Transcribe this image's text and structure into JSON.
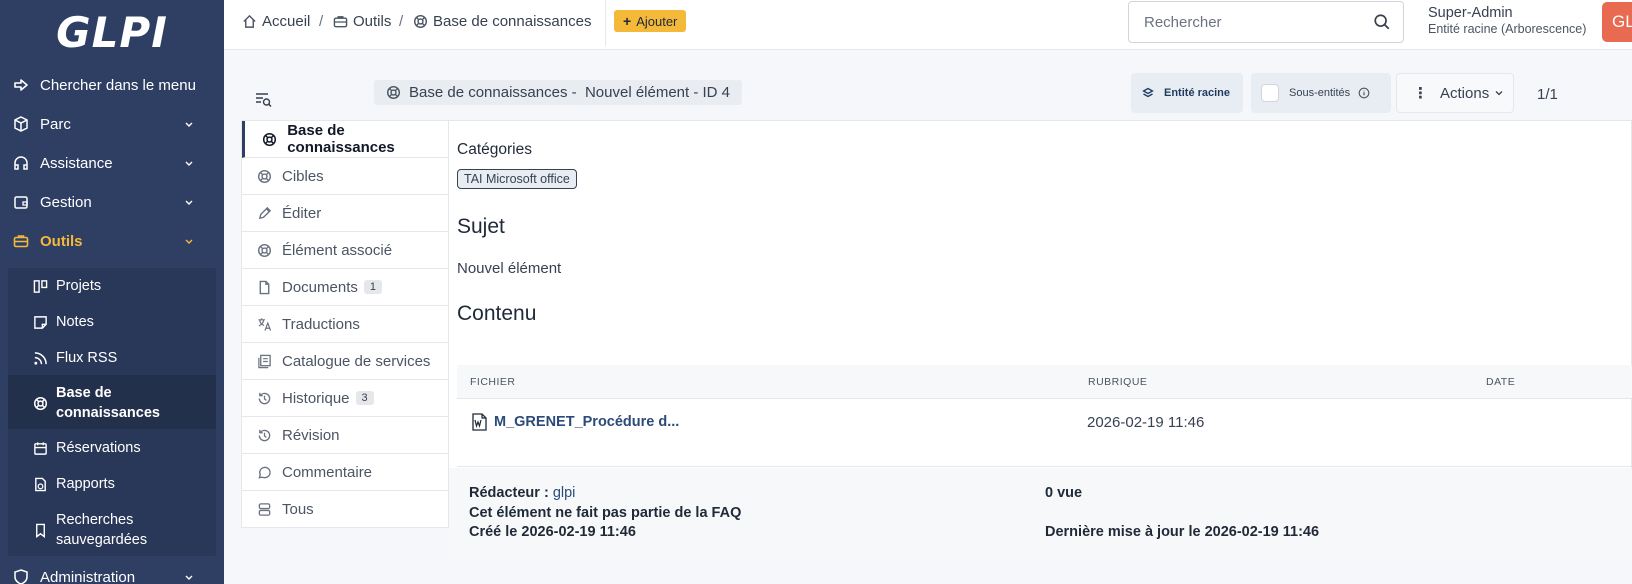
{
  "sidebar": {
    "logo": "GLPI",
    "menu": [
      {
        "label": "Chercher dans le menu",
        "icon": "arrow-right-icon"
      },
      {
        "label": "Parc",
        "icon": "cube-icon"
      },
      {
        "label": "Assistance",
        "icon": "headset-icon"
      },
      {
        "label": "Gestion",
        "icon": "wallet-icon"
      },
      {
        "label": "Outils",
        "icon": "briefcase-icon"
      },
      {
        "label": "Administration",
        "icon": "shield-icon"
      }
    ],
    "submenu": [
      {
        "label": "Projets",
        "icon": "project-icon"
      },
      {
        "label": "Notes",
        "icon": "note-icon"
      },
      {
        "label": "Flux RSS",
        "icon": "rss-icon"
      },
      {
        "label_line1": "Base de",
        "label_line2": "connaissances",
        "icon": "lifebuoy-icon"
      },
      {
        "label": "Réservations",
        "icon": "calendar-icon"
      },
      {
        "label": "Rapports",
        "icon": "report-icon"
      },
      {
        "label_line1": "Recherches",
        "label_line2": "sauvegardées",
        "icon": "bookmark-icon"
      }
    ]
  },
  "breadcrumb": {
    "home": "Accueil",
    "tools": "Outils",
    "kb": "Base de connaissances",
    "sep": "/",
    "add": "Ajouter"
  },
  "search": {
    "placeholder": "Rechercher"
  },
  "user": {
    "name": "Super-Admin",
    "entity": "Entité racine (Arborescence)",
    "avatar": "GL"
  },
  "item": {
    "title_prefix": "Base de connaissances - ",
    "title_rest": "Nouvel élément - ID 4",
    "entity": "Entité racine",
    "sub_entities": "Sous-entités",
    "actions": "Actions",
    "pager": "1/1"
  },
  "tabs": [
    {
      "label": "Base de connaissances",
      "icon": "lifebuoy-icon"
    },
    {
      "label": "Cibles",
      "icon": "lifebuoy-icon"
    },
    {
      "label": "Éditer",
      "icon": "pencil-icon"
    },
    {
      "label": "Élément associé",
      "icon": "lifebuoy-icon"
    },
    {
      "label": "Documents",
      "icon": "file-icon",
      "badge": "1"
    },
    {
      "label": "Traductions",
      "icon": "translate-icon"
    },
    {
      "label": "Catalogue de services",
      "icon": "catalog-icon"
    },
    {
      "label": "Historique",
      "icon": "history-icon",
      "badge": "3"
    },
    {
      "label": "Révision",
      "icon": "history-icon"
    },
    {
      "label": "Commentaire",
      "icon": "comment-icon"
    },
    {
      "label": "Tous",
      "icon": "stack-icon"
    }
  ],
  "content": {
    "categories_heading": "Catégories",
    "category": "TAI Microsoft office",
    "subject_heading": "Sujet",
    "subject": "Nouvel élément",
    "content_heading": "Contenu",
    "table": {
      "headers": [
        "FICHIER",
        "RUBRIQUE",
        "DATE"
      ],
      "rows": [
        {
          "file": "M_GRENET_Procédure d...",
          "rubrique": "2026-02-19 11:46",
          "date": ""
        }
      ]
    },
    "footer": {
      "writer_label": "Rédacteur : ",
      "writer": "glpi",
      "faq": "Cet élément ne fait pas partie de la FAQ",
      "created": "Créé le 2026-02-19 11:46",
      "views": "0 vue",
      "updated": "Dernière mise à jour le 2026-02-19 11:46"
    }
  }
}
